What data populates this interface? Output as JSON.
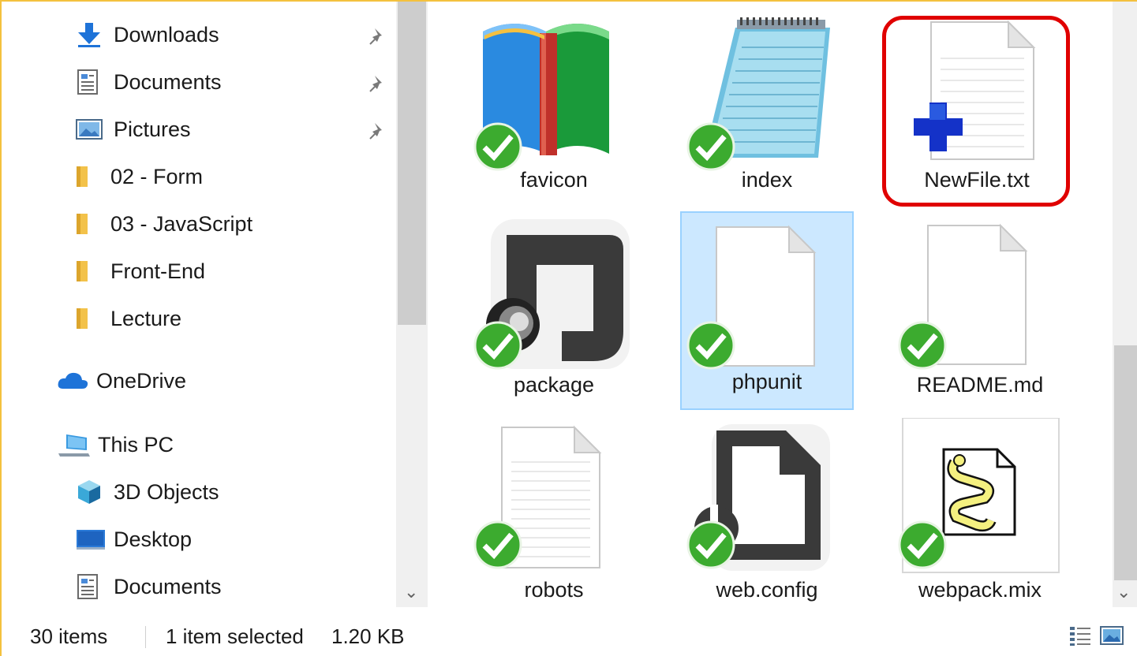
{
  "nav": {
    "items": [
      {
        "label": "Downloads",
        "icon": "download-arrow-icon",
        "pinned": true
      },
      {
        "label": "Documents",
        "icon": "documents-icon",
        "pinned": true
      },
      {
        "label": "Pictures",
        "icon": "pictures-icon",
        "pinned": true
      },
      {
        "label": "02 - Form",
        "icon": "folder-icon",
        "pinned": false
      },
      {
        "label": "03 - JavaScript",
        "icon": "folder-icon",
        "pinned": false
      },
      {
        "label": "Front-End",
        "icon": "folder-icon",
        "pinned": false
      },
      {
        "label": "Lecture",
        "icon": "folder-icon",
        "pinned": false
      },
      {
        "label": "OneDrive",
        "icon": "onedrive-cloud-icon",
        "pinned": false
      },
      {
        "label": "This PC",
        "icon": "this-pc-icon",
        "pinned": false
      },
      {
        "label": "3D Objects",
        "icon": "3d-objects-icon",
        "pinned": false
      },
      {
        "label": "Desktop",
        "icon": "desktop-icon",
        "pinned": false
      },
      {
        "label": "Documents",
        "icon": "documents-icon",
        "pinned": false
      }
    ]
  },
  "files": [
    {
      "name": "favicon",
      "icon": "book-icon",
      "synced": true,
      "selected": false
    },
    {
      "name": "index",
      "icon": "notepad-icon",
      "synced": true,
      "selected": false
    },
    {
      "name": "NewFile.txt",
      "icon": "text-file-new-icon",
      "synced": false,
      "selected": false,
      "highlighted": true
    },
    {
      "name": "package",
      "icon": "json-file-icon",
      "synced": true,
      "selected": false
    },
    {
      "name": "phpunit",
      "icon": "blank-file-icon",
      "synced": true,
      "selected": true
    },
    {
      "name": "README.md",
      "icon": "blank-file-icon",
      "synced": true,
      "selected": false
    },
    {
      "name": "robots",
      "icon": "text-file-icon",
      "synced": true,
      "selected": false
    },
    {
      "name": "web.config",
      "icon": "config-file-icon",
      "synced": true,
      "selected": false
    },
    {
      "name": "webpack.mix",
      "icon": "script-file-icon",
      "synced": true,
      "selected": false
    }
  ],
  "status": {
    "item_count": "30 items",
    "selection": "1 item selected",
    "size": "1.20 KB"
  },
  "colors": {
    "window_border": "#f4c13e",
    "selection_bg": "#cce8ff",
    "selection_border": "#99d1ff",
    "highlight_ring": "#e00000",
    "sync_check": "#3cab2f"
  }
}
